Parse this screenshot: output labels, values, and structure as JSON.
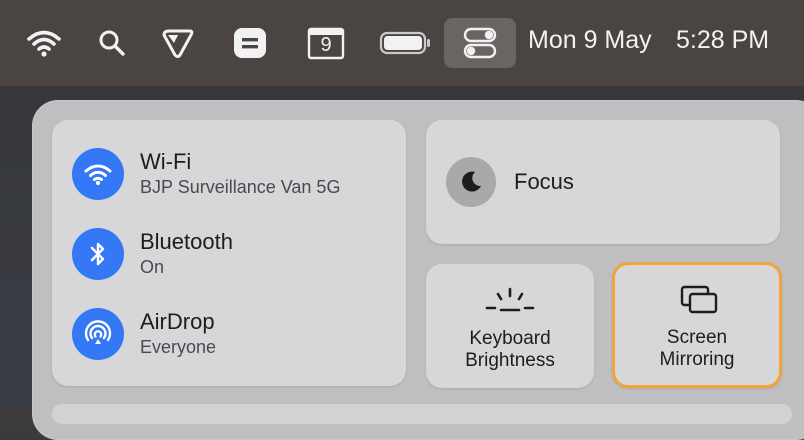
{
  "menubar": {
    "icons": [
      "wifi-icon",
      "search-icon",
      "tag-icon",
      "stacked-app-icon",
      "calendar-icon",
      "battery-icon",
      "control-center-icon"
    ],
    "calendar_day": "9",
    "date": "Mon 9 May",
    "time": "5:28 PM"
  },
  "control_center": {
    "wifi": {
      "title": "Wi-Fi",
      "subtitle": "BJP Surveillance Van 5G"
    },
    "bluetooth": {
      "title": "Bluetooth",
      "subtitle": "On"
    },
    "airdrop": {
      "title": "AirDrop",
      "subtitle": "Everyone"
    },
    "focus": {
      "title": "Focus"
    },
    "keyboard_brightness": {
      "line1": "Keyboard",
      "line2": "Brightness"
    },
    "screen_mirroring": {
      "line1": "Screen",
      "line2": "Mirroring"
    }
  },
  "colors": {
    "accent_blue": "#3478f6",
    "highlight_orange": "#f0a53a"
  }
}
